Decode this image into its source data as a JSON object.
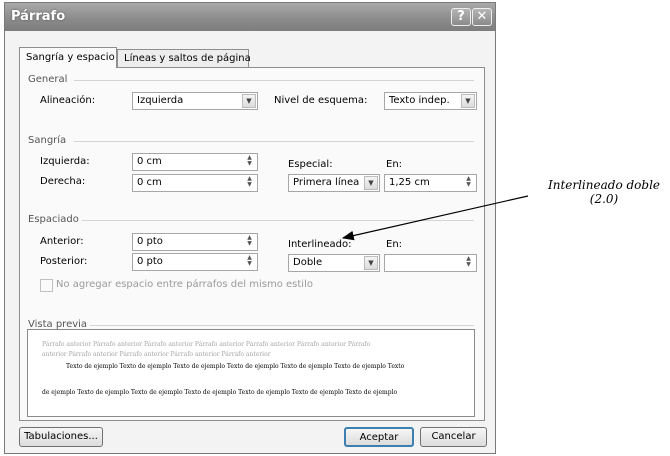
{
  "window": {
    "title": "Párrafo",
    "help_glyph": "?",
    "close_glyph": "✕"
  },
  "tabs": [
    {
      "label": "Sangría y espacio",
      "active": true
    },
    {
      "label": "Líneas y saltos de página",
      "active": false
    }
  ],
  "general": {
    "heading": "General",
    "alignment_label": "Alineación:",
    "alignment_value": "Izquierda",
    "outline_label": "Nivel de esquema:",
    "outline_value": "Texto indep."
  },
  "indent": {
    "heading": "Sangría",
    "left_label": "Izquierda:",
    "left_value": "0 cm",
    "right_label": "Derecha:",
    "right_value": "0 cm",
    "special_label": "Especial:",
    "special_value": "Primera línea",
    "by_label": "En:",
    "by_value": "1,25 cm"
  },
  "spacing": {
    "heading": "Espaciado",
    "before_label": "Anterior:",
    "before_value": "0 pto",
    "after_label": "Posterior:",
    "after_value": "0 pto",
    "line_spacing_label": "Interlineado:",
    "line_spacing_value": "Doble",
    "at_label": "En:",
    "at_value": "",
    "no_space_checkbox_label": "No agregar espacio entre párrafos del mismo estilo",
    "no_space_checked": false
  },
  "preview": {
    "heading": "Vista previa",
    "previous_line_1": "Párrafo anterior Párrafo anterior Párrafo anterior Párrafo anterior Párrafo anterior Párrafo anterior Párrafo",
    "previous_line_2": "anterior Párrafo anterior Párrafo anterior Párrafo anterior Párrafo anterior",
    "sample_line_1": "Texto de ejemplo Texto de ejemplo Texto de ejemplo Texto de ejemplo Texto de ejemplo Texto de ejemplo Texto",
    "sample_line_2": "de ejemplo Texto de ejemplo Texto de ejemplo Texto de ejemplo Texto de ejemplo Texto de ejemplo Texto de ejemplo"
  },
  "buttons": {
    "tabs": "Tabulaciones...",
    "ok": "Aceptar",
    "cancel": "Cancelar"
  },
  "annotation": {
    "line1": "Interlineado doble",
    "line2": "(2.0)"
  },
  "icons": {
    "dropdown": "▼",
    "spin_up": "▲",
    "spin_down": "▼"
  }
}
